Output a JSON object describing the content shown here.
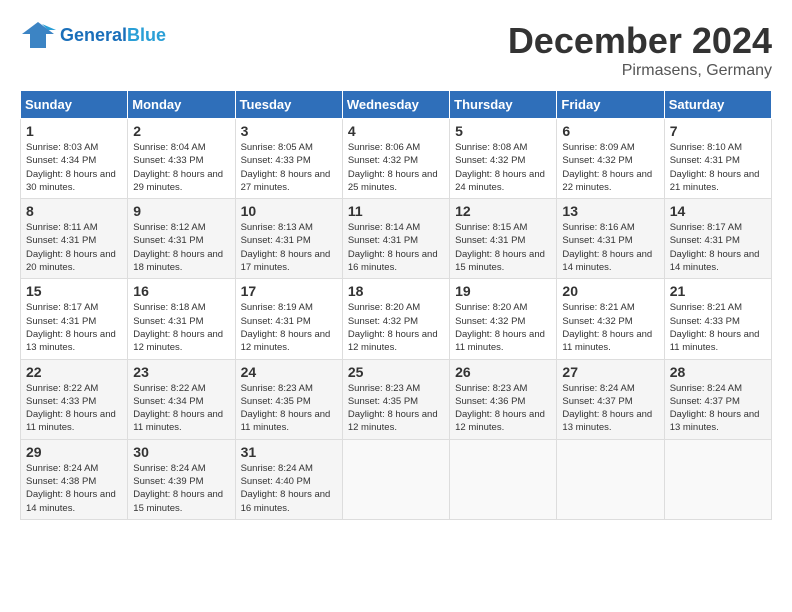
{
  "header": {
    "logo_general": "General",
    "logo_blue": "Blue",
    "month_title": "December 2024",
    "location": "Pirmasens, Germany"
  },
  "days_of_week": [
    "Sunday",
    "Monday",
    "Tuesday",
    "Wednesday",
    "Thursday",
    "Friday",
    "Saturday"
  ],
  "weeks": [
    [
      {
        "day": "1",
        "sunrise": "8:03 AM",
        "sunset": "4:34 PM",
        "daylight": "8 hours and 30 minutes."
      },
      {
        "day": "2",
        "sunrise": "8:04 AM",
        "sunset": "4:33 PM",
        "daylight": "8 hours and 29 minutes."
      },
      {
        "day": "3",
        "sunrise": "8:05 AM",
        "sunset": "4:33 PM",
        "daylight": "8 hours and 27 minutes."
      },
      {
        "day": "4",
        "sunrise": "8:06 AM",
        "sunset": "4:32 PM",
        "daylight": "8 hours and 25 minutes."
      },
      {
        "day": "5",
        "sunrise": "8:08 AM",
        "sunset": "4:32 PM",
        "daylight": "8 hours and 24 minutes."
      },
      {
        "day": "6",
        "sunrise": "8:09 AM",
        "sunset": "4:32 PM",
        "daylight": "8 hours and 22 minutes."
      },
      {
        "day": "7",
        "sunrise": "8:10 AM",
        "sunset": "4:31 PM",
        "daylight": "8 hours and 21 minutes."
      }
    ],
    [
      {
        "day": "8",
        "sunrise": "8:11 AM",
        "sunset": "4:31 PM",
        "daylight": "8 hours and 20 minutes."
      },
      {
        "day": "9",
        "sunrise": "8:12 AM",
        "sunset": "4:31 PM",
        "daylight": "8 hours and 18 minutes."
      },
      {
        "day": "10",
        "sunrise": "8:13 AM",
        "sunset": "4:31 PM",
        "daylight": "8 hours and 17 minutes."
      },
      {
        "day": "11",
        "sunrise": "8:14 AM",
        "sunset": "4:31 PM",
        "daylight": "8 hours and 16 minutes."
      },
      {
        "day": "12",
        "sunrise": "8:15 AM",
        "sunset": "4:31 PM",
        "daylight": "8 hours and 15 minutes."
      },
      {
        "day": "13",
        "sunrise": "8:16 AM",
        "sunset": "4:31 PM",
        "daylight": "8 hours and 14 minutes."
      },
      {
        "day": "14",
        "sunrise": "8:17 AM",
        "sunset": "4:31 PM",
        "daylight": "8 hours and 14 minutes."
      }
    ],
    [
      {
        "day": "15",
        "sunrise": "8:17 AM",
        "sunset": "4:31 PM",
        "daylight": "8 hours and 13 minutes."
      },
      {
        "day": "16",
        "sunrise": "8:18 AM",
        "sunset": "4:31 PM",
        "daylight": "8 hours and 12 minutes."
      },
      {
        "day": "17",
        "sunrise": "8:19 AM",
        "sunset": "4:31 PM",
        "daylight": "8 hours and 12 minutes."
      },
      {
        "day": "18",
        "sunrise": "8:20 AM",
        "sunset": "4:32 PM",
        "daylight": "8 hours and 12 minutes."
      },
      {
        "day": "19",
        "sunrise": "8:20 AM",
        "sunset": "4:32 PM",
        "daylight": "8 hours and 11 minutes."
      },
      {
        "day": "20",
        "sunrise": "8:21 AM",
        "sunset": "4:32 PM",
        "daylight": "8 hours and 11 minutes."
      },
      {
        "day": "21",
        "sunrise": "8:21 AM",
        "sunset": "4:33 PM",
        "daylight": "8 hours and 11 minutes."
      }
    ],
    [
      {
        "day": "22",
        "sunrise": "8:22 AM",
        "sunset": "4:33 PM",
        "daylight": "8 hours and 11 minutes."
      },
      {
        "day": "23",
        "sunrise": "8:22 AM",
        "sunset": "4:34 PM",
        "daylight": "8 hours and 11 minutes."
      },
      {
        "day": "24",
        "sunrise": "8:23 AM",
        "sunset": "4:35 PM",
        "daylight": "8 hours and 11 minutes."
      },
      {
        "day": "25",
        "sunrise": "8:23 AM",
        "sunset": "4:35 PM",
        "daylight": "8 hours and 12 minutes."
      },
      {
        "day": "26",
        "sunrise": "8:23 AM",
        "sunset": "4:36 PM",
        "daylight": "8 hours and 12 minutes."
      },
      {
        "day": "27",
        "sunrise": "8:24 AM",
        "sunset": "4:37 PM",
        "daylight": "8 hours and 13 minutes."
      },
      {
        "day": "28",
        "sunrise": "8:24 AM",
        "sunset": "4:37 PM",
        "daylight": "8 hours and 13 minutes."
      }
    ],
    [
      {
        "day": "29",
        "sunrise": "8:24 AM",
        "sunset": "4:38 PM",
        "daylight": "8 hours and 14 minutes."
      },
      {
        "day": "30",
        "sunrise": "8:24 AM",
        "sunset": "4:39 PM",
        "daylight": "8 hours and 15 minutes."
      },
      {
        "day": "31",
        "sunrise": "8:24 AM",
        "sunset": "4:40 PM",
        "daylight": "8 hours and 16 minutes."
      },
      null,
      null,
      null,
      null
    ]
  ],
  "labels": {
    "sunrise": "Sunrise:",
    "sunset": "Sunset:",
    "daylight": "Daylight:"
  }
}
